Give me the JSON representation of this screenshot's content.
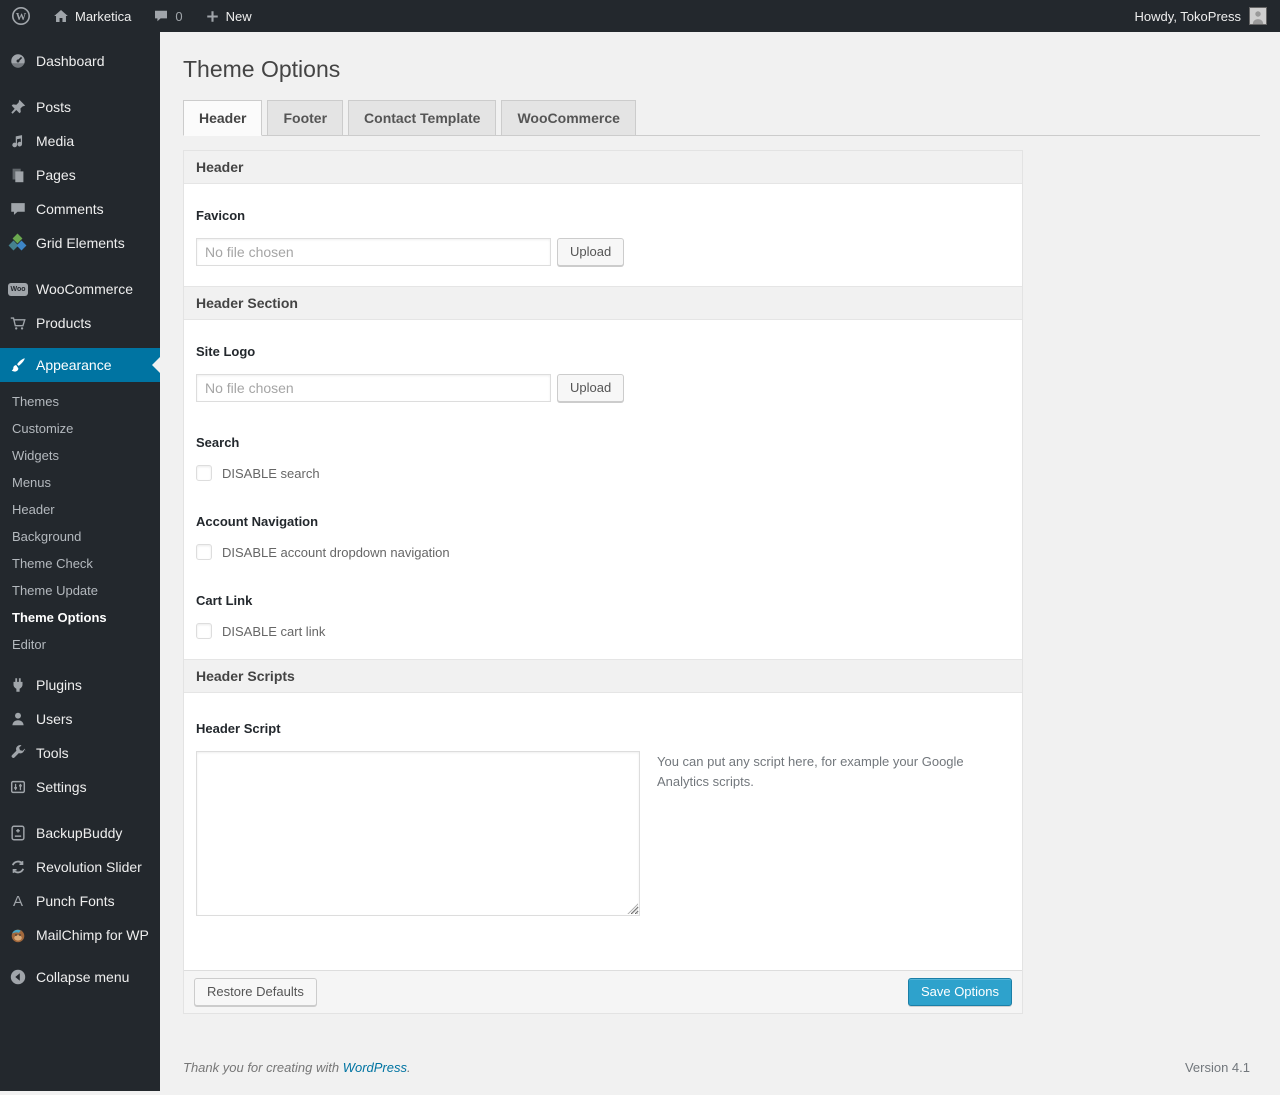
{
  "admin_bar": {
    "site_name": "Marketica",
    "comments_count": "0",
    "new_label": "New",
    "howdy": "Howdy, TokoPress"
  },
  "sidebar": {
    "items": [
      {
        "label": "Dashboard",
        "icon": "dashboard-icon"
      },
      {
        "label": "Posts",
        "icon": "posts-icon",
        "separator_before": true
      },
      {
        "label": "Media",
        "icon": "media-icon"
      },
      {
        "label": "Pages",
        "icon": "pages-icon"
      },
      {
        "label": "Comments",
        "icon": "comments-icon"
      },
      {
        "label": "Grid Elements",
        "icon": "grid-elements-icon"
      },
      {
        "label": "WooCommerce",
        "icon": "woocommerce-icon",
        "separator_before": true
      },
      {
        "label": "Products",
        "icon": "products-icon"
      },
      {
        "label": "Appearance",
        "icon": "appearance-icon",
        "active": true,
        "separator_before": true,
        "separator_small": true,
        "submenu": [
          {
            "label": "Themes"
          },
          {
            "label": "Customize"
          },
          {
            "label": "Widgets"
          },
          {
            "label": "Menus"
          },
          {
            "label": "Header"
          },
          {
            "label": "Background"
          },
          {
            "label": "Theme Check"
          },
          {
            "label": "Theme Update"
          },
          {
            "label": "Theme Options",
            "current": true
          },
          {
            "label": "Editor"
          }
        ]
      },
      {
        "label": "Plugins",
        "icon": "plugins-icon"
      },
      {
        "label": "Users",
        "icon": "users-icon"
      },
      {
        "label": "Tools",
        "icon": "tools-icon"
      },
      {
        "label": "Settings",
        "icon": "settings-icon"
      },
      {
        "label": "BackupBuddy",
        "icon": "backupbuddy-icon",
        "separator_before": true
      },
      {
        "label": "Revolution Slider",
        "icon": "revolution-slider-icon"
      },
      {
        "label": "Punch Fonts",
        "icon": "punch-fonts-icon"
      },
      {
        "label": "MailChimp for WP",
        "icon": "mailchimp-icon"
      },
      {
        "label": "Collapse menu",
        "icon": "collapse-icon",
        "separator_before": true,
        "separator_small": true
      }
    ]
  },
  "page": {
    "title": "Theme Options",
    "tabs": [
      {
        "label": "Header",
        "active": true
      },
      {
        "label": "Footer"
      },
      {
        "label": "Contact Template"
      },
      {
        "label": "WooCommerce"
      }
    ]
  },
  "panel": {
    "section_header_title": "Header",
    "section_header_section_title": "Header Section",
    "section_header_scripts_title": "Header Scripts",
    "favicon": {
      "label": "Favicon",
      "placeholder": "No file chosen",
      "button": "Upload"
    },
    "site_logo": {
      "label": "Site Logo",
      "placeholder": "No file chosen",
      "button": "Upload"
    },
    "search": {
      "label": "Search",
      "checkbox_label": "DISABLE search",
      "checked": false
    },
    "account_nav": {
      "label": "Account Navigation",
      "checkbox_label": "DISABLE account dropdown navigation",
      "checked": false
    },
    "cart_link": {
      "label": "Cart Link",
      "checkbox_label": "DISABLE cart link",
      "checked": false
    },
    "header_script": {
      "label": "Header Script",
      "value": "",
      "note": "You can put any script here, for example your Google Analytics scripts."
    },
    "footer": {
      "restore_label": "Restore Defaults",
      "save_label": "Save Options"
    }
  },
  "footer": {
    "thanks_prefix": "Thank you for creating with ",
    "link_text": "WordPress",
    "suffix": ".",
    "version": "Version 4.1"
  },
  "colors": {
    "admin_dark": "#23282d",
    "menu_highlight": "#0074a2",
    "primary_button": "#2ea2cc",
    "page_background": "#f1f1f1",
    "icon_gray": "#a0a5aa"
  }
}
